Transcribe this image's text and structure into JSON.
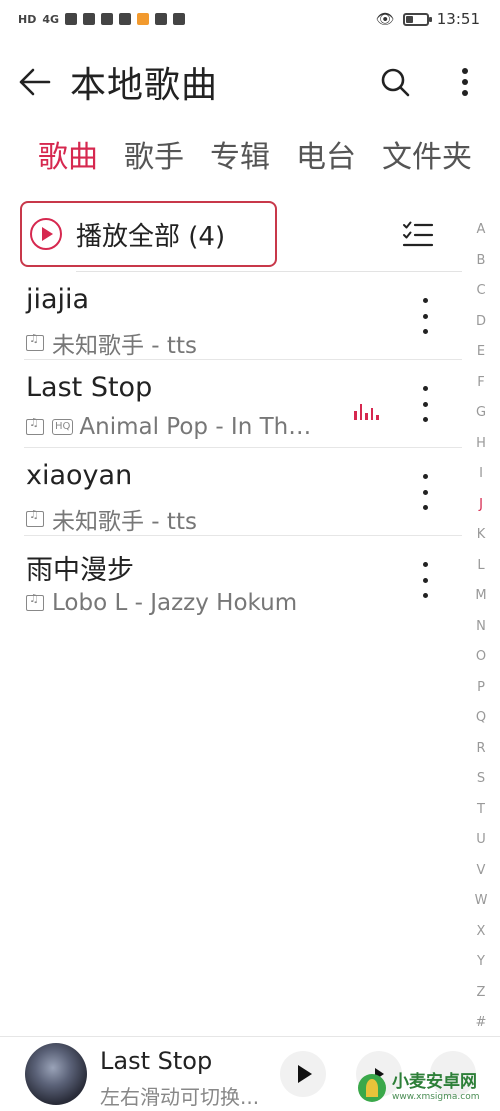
{
  "status_bar": {
    "network_label": "HD",
    "signal_label": "4G",
    "time": "13:51",
    "battery_percent": 35
  },
  "header": {
    "title": "本地歌曲",
    "back_icon": "arrow-left-icon",
    "search_icon": "search-icon",
    "more_icon": "more-vertical-icon"
  },
  "tabs": [
    {
      "label": "歌曲",
      "active": true
    },
    {
      "label": "歌手",
      "active": false
    },
    {
      "label": "专辑",
      "active": false
    },
    {
      "label": "电台",
      "active": false
    },
    {
      "label": "文件夹",
      "active": false
    }
  ],
  "play_all": {
    "label": "播放全部 (4)",
    "icon": "play-circle-icon"
  },
  "songs": [
    {
      "title": "jiajia",
      "subtitle": "未知歌手 - tts",
      "hq": false,
      "playing": false
    },
    {
      "title": "Last Stop",
      "subtitle": "Animal Pop - In Th…",
      "hq": true,
      "hq_label": "HQ",
      "playing": true
    },
    {
      "title": "xiaoyan",
      "subtitle": "未知歌手 - tts",
      "hq": false,
      "playing": false
    },
    {
      "title": "雨中漫步",
      "subtitle": "Lobo L - Jazzy Hokum",
      "hq": false,
      "playing": false
    }
  ],
  "alphabet": [
    "A",
    "B",
    "C",
    "D",
    "E",
    "F",
    "G",
    "H",
    "I",
    "J",
    "K",
    "L",
    "M",
    "N",
    "O",
    "P",
    "Q",
    "R",
    "S",
    "T",
    "U",
    "V",
    "W",
    "X",
    "Y",
    "Z",
    "#"
  ],
  "alphabet_active": "J",
  "player": {
    "title": "Last Stop",
    "subtitle": "左右滑动可切换..."
  },
  "watermark": {
    "title": "小麦安卓网",
    "url": "www.xmsigma.com"
  },
  "colors": {
    "accent": "#d6284f",
    "highlight_border": "#c8384a"
  }
}
